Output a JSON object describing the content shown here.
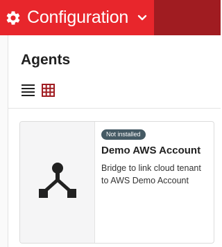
{
  "header": {
    "title": "Configuration",
    "gear_icon": "gear-icon",
    "chevron_icon": "chevron-down-icon",
    "accent_color": "#e8262c",
    "dark_color": "#a01c21"
  },
  "page": {
    "heading": "Agents",
    "view_toggle": {
      "list_icon": "list-view-icon",
      "grid_icon": "grid-view-icon",
      "active": "grid"
    }
  },
  "cards": [
    {
      "badge": "Not installed",
      "title": "Demo AWS Account",
      "description": "Bridge to link cloud tenant to AWS Demo Account",
      "icon": "network-agent-icon"
    }
  ]
}
